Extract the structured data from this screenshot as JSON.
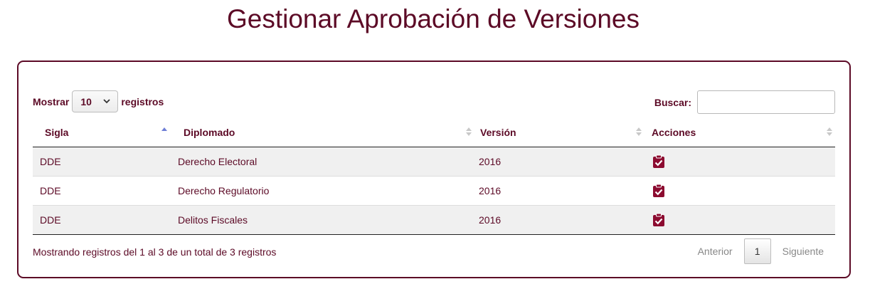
{
  "page": {
    "title": "Gestionar Aprobación de Versiones"
  },
  "length_menu": {
    "prefix": "Mostrar",
    "selected": "10",
    "suffix": "registros"
  },
  "search": {
    "label": "Buscar:",
    "value": "",
    "placeholder": ""
  },
  "table": {
    "columns": [
      {
        "label": "Sigla",
        "sort": "ascending"
      },
      {
        "label": "Diplomado",
        "sort": "none"
      },
      {
        "label": "Versión",
        "sort": "none"
      },
      {
        "label": "Acciones",
        "sort": "none"
      }
    ],
    "rows": [
      {
        "sigla": "DDE",
        "diplomado": "Derecho Electoral",
        "version": "2016",
        "action_icon": "clipboard-check-icon"
      },
      {
        "sigla": "DDE",
        "diplomado": "Derecho Regulatorio",
        "version": "2016",
        "action_icon": "clipboard-check-icon"
      },
      {
        "sigla": "DDE",
        "diplomado": "Delitos Fiscales",
        "version": "2016",
        "action_icon": "clipboard-check-icon"
      }
    ]
  },
  "info": "Mostrando registros del 1 al 3 de un total de 3 registros",
  "pagination": {
    "previous": "Anterior",
    "current": "1",
    "next": "Siguiente"
  },
  "colors": {
    "primary": "#5c0a26",
    "icon": "#8c0b30",
    "sort_active": "#6f7fd6",
    "sort_inactive": "#c8c8c8"
  }
}
